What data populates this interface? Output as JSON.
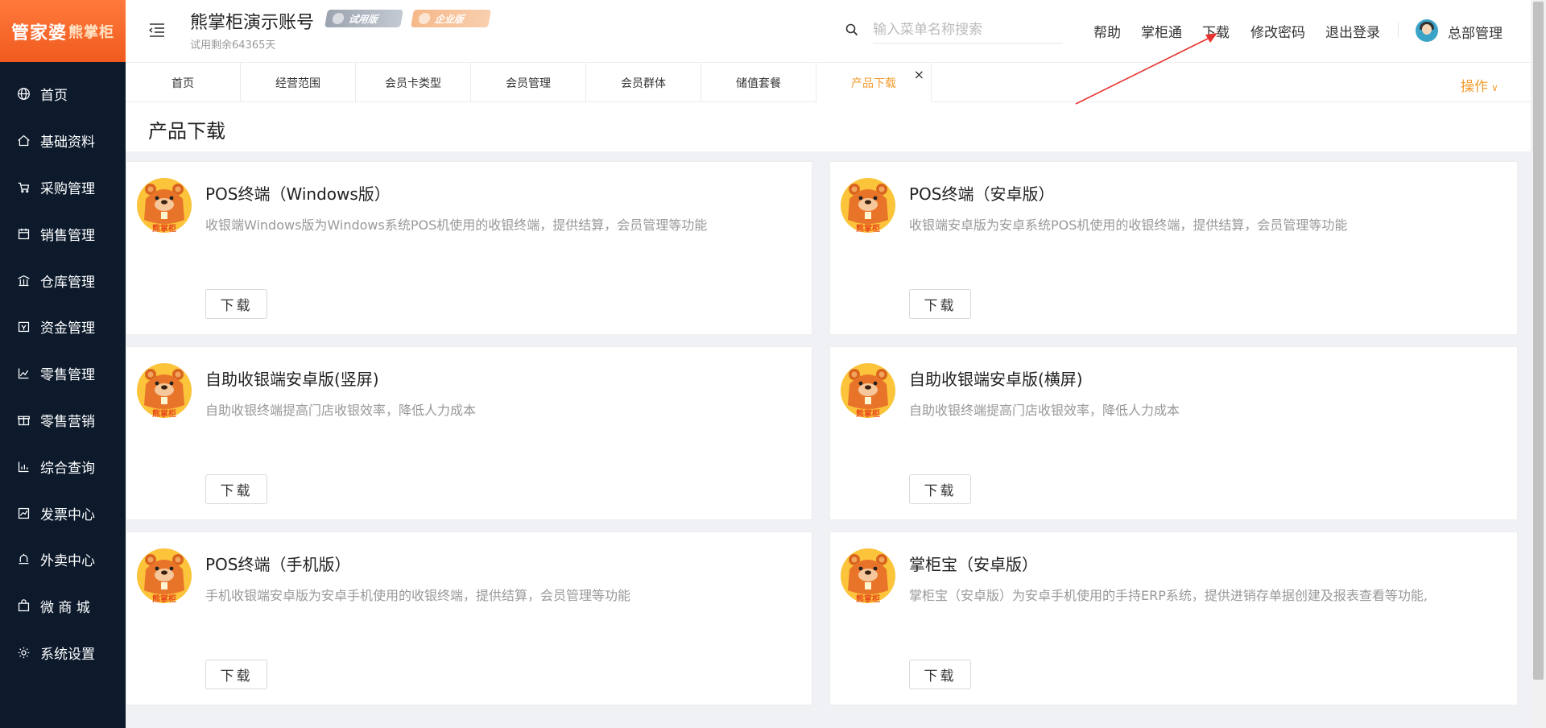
{
  "brand": {
    "logo_main": "管家婆",
    "logo_sub": "熊掌柜"
  },
  "sidebar": {
    "items": [
      {
        "label": "首页",
        "icon": "globe-icon"
      },
      {
        "label": "基础资料",
        "icon": "home-icon"
      },
      {
        "label": "采购管理",
        "icon": "cart-icon"
      },
      {
        "label": "销售管理",
        "icon": "calendar-icon"
      },
      {
        "label": "仓库管理",
        "icon": "warehouse-icon"
      },
      {
        "label": "资金管理",
        "icon": "wallet-icon"
      },
      {
        "label": "零售管理",
        "icon": "bar-chart-icon"
      },
      {
        "label": "零售营销",
        "icon": "gift-icon"
      },
      {
        "label": "综合查询",
        "icon": "column-chart-icon"
      },
      {
        "label": "发票中心",
        "icon": "line-chart-icon"
      },
      {
        "label": "外卖中心",
        "icon": "bell-icon"
      },
      {
        "label": "微 商 城",
        "icon": "bag-icon"
      },
      {
        "label": "系统设置",
        "icon": "gear-icon"
      }
    ]
  },
  "header": {
    "account_name": "熊掌柜演示账号",
    "trial_remaining": "试用剩余64365天",
    "badge_trial": "试用版",
    "badge_enterprise": "企业版",
    "search_placeholder": "输入菜单名称搜索",
    "links": {
      "help": "帮助",
      "zhangguitong": "掌柜通",
      "download": "下载",
      "change_password": "修改密码",
      "logout": "退出登录"
    },
    "user_name": "总部管理"
  },
  "tabs": {
    "items": [
      "首页",
      "经营范围",
      "会员卡类型",
      "会员管理",
      "会员群体",
      "储值套餐",
      "产品下载"
    ],
    "active_index": 6,
    "close_symbol": "×",
    "operations_label": "操作",
    "operations_chevron": "∨"
  },
  "page": {
    "title": "产品下载"
  },
  "products": [
    {
      "title": "POS终端（Windows版）",
      "desc": "收银端Windows版为Windows系统POS机使用的收银终端，提供结算，会员管理等功能",
      "button": "下载",
      "logo_text": "熊掌柜"
    },
    {
      "title": "POS终端（安卓版）",
      "desc": "收银端安卓版为安卓系统POS机使用的收银终端，提供结算，会员管理等功能",
      "button": "下载",
      "logo_text": "熊掌柜"
    },
    {
      "title": "自助收银端安卓版(竖屏)",
      "desc": "自助收银终端提高门店收银效率，降低人力成本",
      "button": "下载",
      "logo_text": "熊掌柜"
    },
    {
      "title": "自助收银端安卓版(横屏)",
      "desc": "自助收银终端提高门店收银效率，降低人力成本",
      "button": "下载",
      "logo_text": "熊掌柜"
    },
    {
      "title": "POS终端（手机版）",
      "desc": "手机收银端安卓版为安卓手机使用的收银终端，提供结算，会员管理等功能",
      "button": "下载",
      "logo_text": "熊掌柜"
    },
    {
      "title": "掌柜宝（安卓版）",
      "desc": "掌柜宝（安卓版）为安卓手机使用的手持ERP系统，提供进销存单据创建及报表查看等功能,",
      "button": "下载",
      "logo_text": "熊掌柜"
    }
  ],
  "colors": {
    "sidebar_bg": "#0c1a2c",
    "accent": "#f39c2f",
    "logo_orange": "#f05a1e",
    "annotation_red": "#e8322e"
  }
}
